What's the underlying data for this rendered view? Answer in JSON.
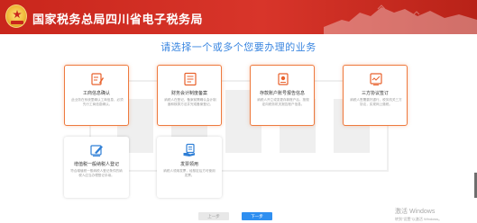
{
  "header": {
    "title": "国家税务总局四川省电子税务局",
    "bg_color": "#c9261c"
  },
  "heading": "请选择一个或多个您要办理的业务",
  "cards": [
    {
      "title": "工商信息确认",
      "desc": "此业务在系统里确认工商信息，必须先行工商信息确认。",
      "icon": "form-edit-icon",
      "selected": true
    },
    {
      "title": "财务会计制度备案",
      "desc": "纳税人在登记，备案前需确认会计制度和核算方法并完成备案登记。",
      "icon": "document-list-icon",
      "selected": true
    },
    {
      "title": "存款账户账号报告信息",
      "desc": "纳税人开立或变更存款账户后，按规定向税务机关报告账户信息。",
      "icon": "bank-account-icon",
      "selected": true
    },
    {
      "title": "三方协议签订",
      "desc": "纳税人签署委托银行、税务机关三方协议，实现网上缴税。",
      "icon": "agreement-icon",
      "selected": true
    },
    {
      "title": "增值税一般纳税人登记",
      "desc": "符合增值税一般纳税人登记条件的纳税人应当办理登记手续。",
      "icon": "taxpayer-register-icon",
      "selected": false
    },
    {
      "title": "发票领用",
      "desc": "纳税人领用发票，经核定后方可使用发票。",
      "icon": "invoice-hand-icon",
      "selected": false
    }
  ],
  "buttons": {
    "prev": "上一步",
    "next": "下一步"
  },
  "watermark": {
    "line1": "激活 Windows",
    "line2": "转到\"设置\"以激活 Windows。"
  },
  "colors": {
    "accent": "#3a86e0",
    "selected_border": "#ee7a3e",
    "next_button": "#2f8ff0"
  }
}
